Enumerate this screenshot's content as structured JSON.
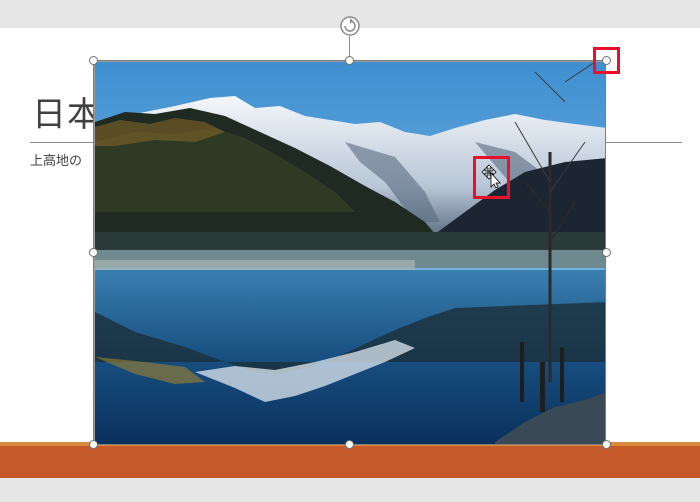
{
  "slide": {
    "title": "日本",
    "subtitle": "上高地の"
  },
  "picture": {
    "subject": "mountain-lake-reflection"
  },
  "colors": {
    "accent_bar": "#c45a2a",
    "highlight": "#e8102a"
  }
}
